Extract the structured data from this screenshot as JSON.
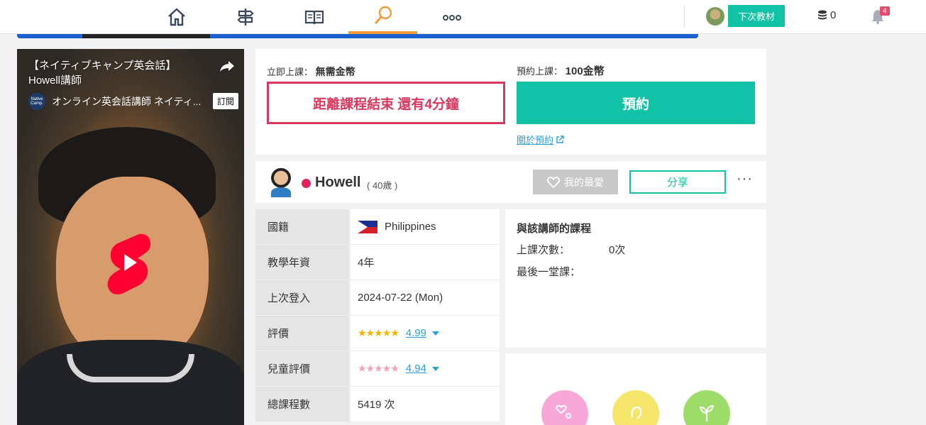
{
  "nav": {
    "items": [
      {
        "name": "home-icon"
      },
      {
        "name": "signpost-icon"
      },
      {
        "name": "book-icon"
      },
      {
        "name": "search-icon",
        "active": true
      },
      {
        "name": "more-icon"
      }
    ],
    "material_button": "下次教材",
    "coins": "0",
    "notification_count": "4"
  },
  "video": {
    "title_line1": "【ネイティブキャンプ英会話】",
    "title_line2": "Howell講師",
    "channel_logo": "Native Camp.",
    "channel_name": "オンライン英会話講師 ネイティ...",
    "subscribe": "訂閱"
  },
  "booking": {
    "instant_label": "立即上課：",
    "instant_price": "無需金幣",
    "reserve_label": "預約上課：",
    "reserve_price": "100金幣",
    "remaining_button": "距離課程結束 還有4分鐘",
    "reserve_button": "預約",
    "about_link": "關於預約"
  },
  "tutor": {
    "name": "Howell",
    "age": "( 40歲 )",
    "favorite_button": "我的最愛",
    "share_button": "分享",
    "more": "···"
  },
  "info": {
    "rows": [
      {
        "label": "國籍",
        "value": "Philippines"
      },
      {
        "label": "教學年資",
        "value": "4年"
      },
      {
        "label": "上次登入",
        "value": "2024-07-22 (Mon)"
      },
      {
        "label": "評價",
        "value": "4.99",
        "stars": "★★★★★"
      },
      {
        "label": "兒童評價",
        "value": "4.94",
        "stars": "★★★★★"
      },
      {
        "label": "總課程數",
        "value": "5419 次"
      }
    ]
  },
  "lessons": {
    "title": "與該講師的課程",
    "count_label": "上課次數：",
    "count_value": "0次",
    "last_label": "最後一堂課："
  },
  "colors": {
    "accent": "#11c2a6",
    "danger": "#d9395f",
    "link": "#2a9fd6",
    "active_tab": "#f39b3c",
    "star_gold": "#f5b400",
    "star_pink": "#f0a3b5"
  }
}
